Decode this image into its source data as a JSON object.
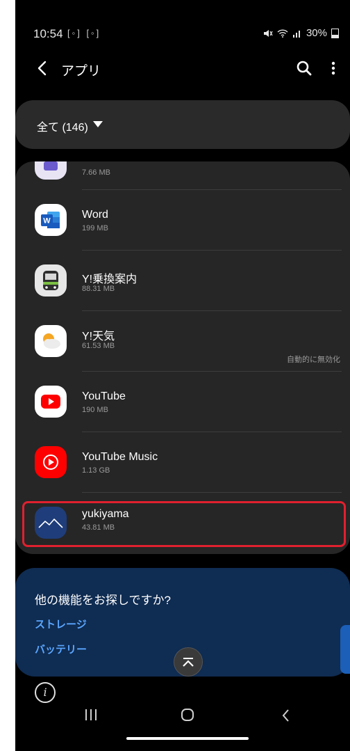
{
  "status_bar": {
    "time": "10:54",
    "left_icons": "[◦] [◦]",
    "battery": "30%"
  },
  "header": {
    "title": "アプリ",
    "back_icon": "chevron-left-icon",
    "search_icon": "search-icon",
    "more_icon": "more-vert-icon"
  },
  "filter": {
    "label": "全て (146)",
    "dropdown_icon": "triangle-down-icon"
  },
  "apps": [
    {
      "name": "",
      "size": "7.66 MB",
      "note": "",
      "icon": "partial-app-icon"
    },
    {
      "name": "Word",
      "size": "199 MB",
      "note": "",
      "icon": "word-icon"
    },
    {
      "name": "Y!乗換案内",
      "size": "88.31 MB",
      "note": "",
      "icon": "train-icon"
    },
    {
      "name": "Y!天気",
      "size": "61.53 MB",
      "note": "自動的に無効化",
      "icon": "weather-icon"
    },
    {
      "name": "YouTube",
      "size": "190 MB",
      "note": "",
      "icon": "youtube-icon"
    },
    {
      "name": "YouTube Music",
      "size": "1.13 GB",
      "note": "",
      "icon": "youtube-music-icon"
    },
    {
      "name": "yukiyama",
      "size": "43.81 MB",
      "note": "",
      "icon": "mountain-icon"
    }
  ],
  "more_features": {
    "question": "他の機能をお探しですか?",
    "link_storage": "ストレージ",
    "link_battery": "バッテリー"
  },
  "colors": {
    "highlight": "#e0202f",
    "link": "#5aa6ff",
    "card_bg": "#0f2c52"
  }
}
